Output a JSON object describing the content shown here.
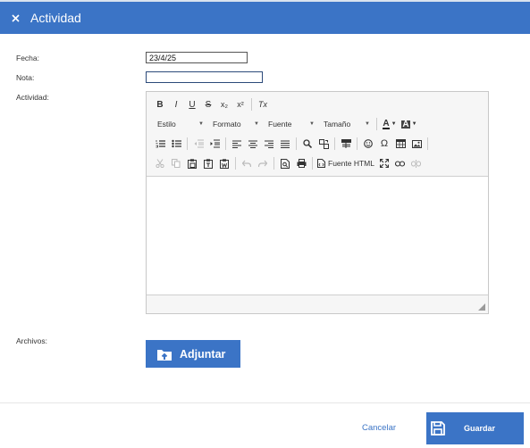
{
  "dialog": {
    "title": "Actividad",
    "close_icon": "close-icon"
  },
  "form": {
    "fecha_label": "Fecha:",
    "fecha_value": "23/4/25",
    "nota_label": "Nota:",
    "nota_value": "",
    "actividad_label": "Actividad:",
    "archivos_label": "Archivos:"
  },
  "editor": {
    "row1": [
      "B",
      "I",
      "U",
      "S",
      "x₂",
      "x²",
      "Tx"
    ],
    "combos": {
      "estilo": "Estilo",
      "formato": "Formato",
      "fuente": "Fuente",
      "tamano": "Tamaño"
    },
    "color_text": "A",
    "color_bg": "A",
    "source_label": "Fuente HTML",
    "content": ""
  },
  "attach": {
    "label": "Adjuntar",
    "icon": "upload-folder-icon"
  },
  "footer": {
    "cancel_label": "Cancelar",
    "save_label": "Guardar",
    "save_icon": "floppy-disk-icon"
  },
  "colors": {
    "accent": "#3b74c6",
    "toolbar_bg": "#f6f6f6"
  }
}
